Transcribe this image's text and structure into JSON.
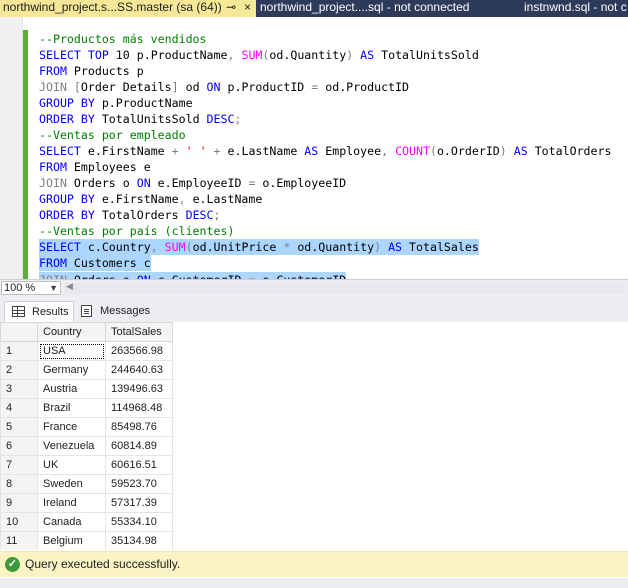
{
  "tabs": [
    {
      "label": "northwind_project.s...SS.master (sa (64))",
      "pin": "⊸",
      "close": "×"
    },
    {
      "label": "northwind_project....sql - not connected"
    },
    {
      "label": "instnwnd.sql - not c"
    }
  ],
  "editor": {
    "lines": [
      "--Productos más vendidos",
      "SELECT TOP 10 p.ProductName, SUM(od.Quantity) AS TotalUnitsSold",
      "FROM Products p",
      "JOIN [Order Details] od ON p.ProductID = od.ProductID",
      "GROUP BY p.ProductName",
      "ORDER BY TotalUnitsSold DESC;",
      "--Ventas por empleado",
      "SELECT e.FirstName + ' ' + e.LastName AS Employee, COUNT(o.OrderID) AS TotalOrders",
      "FROM Employees e",
      "JOIN Orders o ON e.EmployeeID = o.EmployeeID",
      "GROUP BY e.FirstName, e.LastName",
      "ORDER BY TotalOrders DESC;",
      "--Ventas por país (clientes)",
      "SELECT c.Country, SUM(od.UnitPrice * od.Quantity) AS TotalSales",
      "FROM Customers c",
      "JOIN Orders o ON c.CustomerID = o.CustomerID"
    ]
  },
  "zoom": {
    "value": "100 %",
    "icon": "dropdown-arrow-icon"
  },
  "results_tabs": [
    {
      "label": "Results",
      "icon": "grid-icon"
    },
    {
      "label": "Messages",
      "icon": "messages-icon"
    }
  ],
  "grid": {
    "columns": [
      "",
      "Country",
      "TotalSales"
    ],
    "rows": [
      [
        "1",
        "USA",
        "263566.98"
      ],
      [
        "2",
        "Germany",
        "244640.63"
      ],
      [
        "3",
        "Austria",
        "139496.63"
      ],
      [
        "4",
        "Brazil",
        "114968.48"
      ],
      [
        "5",
        "France",
        "85498.76"
      ],
      [
        "6",
        "Venezuela",
        "60814.89"
      ],
      [
        "7",
        "UK",
        "60616.51"
      ],
      [
        "8",
        "Sweden",
        "59523.70"
      ],
      [
        "9",
        "Ireland",
        "57317.39"
      ],
      [
        "10",
        "Canada",
        "55334.10"
      ],
      [
        "11",
        "Belgium",
        "35134.98"
      ]
    ]
  },
  "status": {
    "text": "Query executed successfully.",
    "icon": "check-circle-icon"
  },
  "colors": {
    "tab_bar": "#2d3a5a",
    "active_tab": "#f6e897",
    "keyword": "#0000ff",
    "function": "#ff00ff",
    "comment": "#008000",
    "selection": "#add6ff",
    "status_bar": "#fcf3c5",
    "success": "#3c9a3c"
  }
}
